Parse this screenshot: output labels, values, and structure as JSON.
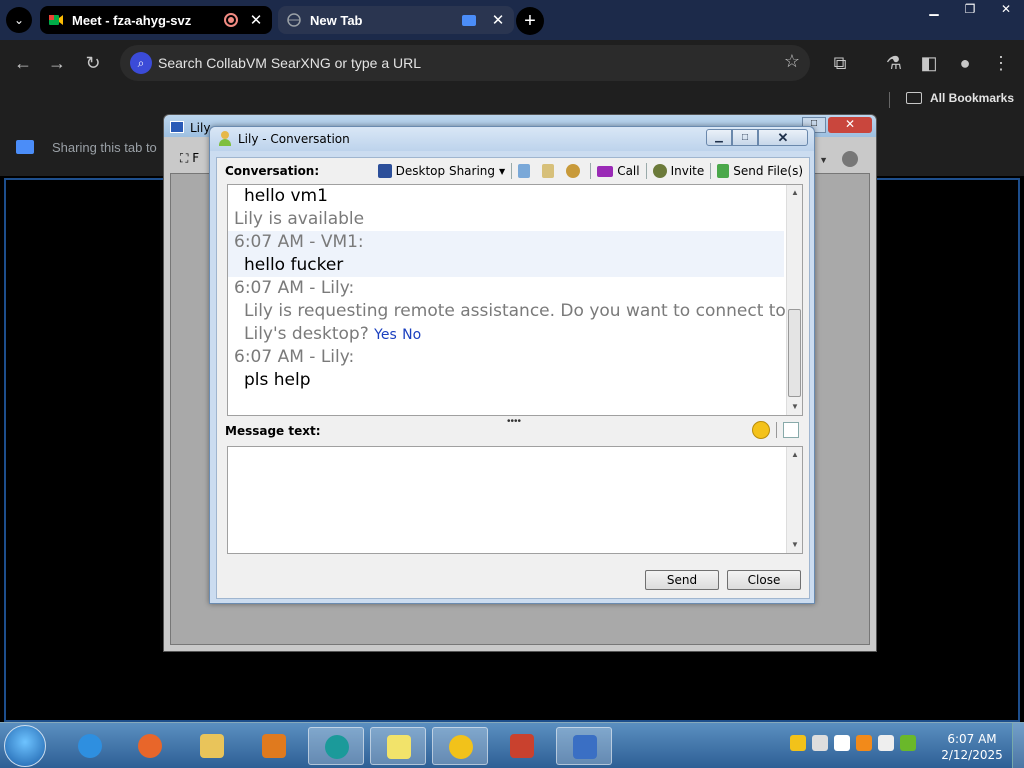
{
  "browser": {
    "tabs": [
      {
        "title": "Meet - fza-ahyg-svz",
        "active": true
      },
      {
        "title": "New Tab",
        "active": false
      }
    ],
    "omnibox_placeholder": "Search CollabVM SearXNG or type a URL",
    "bookmarks_all": "All Bookmarks",
    "sharing_text": "Sharing this tab to"
  },
  "bg_window": {
    "title": "Lily",
    "toolbar_label": "F"
  },
  "conversation": {
    "title": "Lily - Conversation",
    "label": "Conversation:",
    "tools": {
      "desktop_sharing": "Desktop Sharing",
      "call": "Call",
      "invite": "Invite",
      "send_files": "Send File(s)"
    },
    "transcript": {
      "line1": "hello vm1",
      "line2": "Lily is available",
      "line3": "6:07 AM - VM1:",
      "line4": "hello fucker",
      "line5": "6:07 AM - Lily:",
      "line6": "Lily is requesting remote assistance. Do you want to connect to",
      "line7": "Lily's desktop?",
      "yes": "Yes",
      "no": "No",
      "line8": "6:07 AM - Lily:",
      "line9": "pls help"
    },
    "message_label": "Message text:",
    "message_value": "",
    "send_button": "Send",
    "close_button": "Close"
  },
  "taskbar": {
    "time": "6:07 AM",
    "date": "2/12/2025"
  },
  "colors": {
    "chrome_tabstrip": "#1c2a4a",
    "chrome_toolbar": "#1f1f1f",
    "link_blue": "#1a3fbf",
    "taskbar": "#2e5f95"
  }
}
